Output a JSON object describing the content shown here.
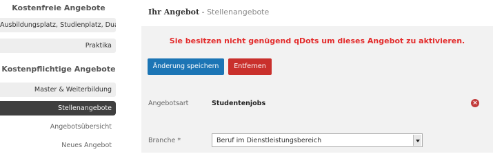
{
  "sidebar": {
    "free_heading": "Kostenfreie Angebote",
    "free_items": [
      {
        "label": "Ausbildungsplatz, Studienplatz, Dual"
      },
      {
        "label": "Praktika"
      }
    ],
    "paid_heading": "Kostenpflichtige Angebote",
    "paid_items": [
      {
        "label": "Master & Weiterbildung"
      },
      {
        "label": "Stellenangebote"
      }
    ],
    "sub_items": [
      {
        "label": "Angebotsübersicht"
      },
      {
        "label": "Neues Angebot"
      }
    ]
  },
  "main": {
    "title_strong": "Ihr Angebot",
    "title_sep": " - ",
    "title_sub": "Stellenangebote",
    "alert": "Sie besitzen nicht genügend qDots um dieses Angebot zu aktivieren.",
    "save_button": "Änderung speichern",
    "remove_button": "Entfernen",
    "offer_type_label": "Angebotsart",
    "offer_type_value": "Studentenjobs",
    "branch_label": "Branche *",
    "branch_value": "Beruf im Dienstleistungsbereich"
  },
  "icons": {
    "remove": "remove-circle-icon",
    "dropdown": "chevron-down-icon"
  },
  "colors": {
    "primary_button": "#1c75b5",
    "danger_button": "#c9302c",
    "alert_text": "#e32b2b",
    "active_nav": "#3f3f3f"
  }
}
